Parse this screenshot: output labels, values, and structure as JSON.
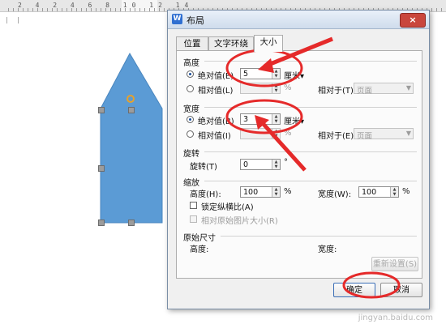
{
  "ruler": {
    "numbers": "2 4 2 4 6 8 10 12 14"
  },
  "dialog": {
    "app_icon": "W",
    "title": "布局",
    "close_label": "×",
    "tabs": [
      {
        "label": "位置"
      },
      {
        "label": "文字环绕"
      },
      {
        "label": "大小"
      }
    ],
    "height_section": {
      "title": "高度",
      "absolute_label": "绝对值(E)",
      "absolute_value": "5",
      "absolute_unit": "厘米",
      "relative_label": "相对值(L)",
      "relative_value": "",
      "relative_unit": "%",
      "relative_to_label": "相对于(T)",
      "relative_to_value": "页面"
    },
    "width_section": {
      "title": "宽度",
      "absolute_label": "绝对值(B)",
      "absolute_value": "3",
      "absolute_unit": "厘米",
      "relative_label": "相对值(I)",
      "relative_value": "",
      "relative_unit": "%",
      "relative_to_label": "相对于(E)",
      "relative_to_value": "页面"
    },
    "rotate_section": {
      "title": "旋转",
      "label": "旋转(T)",
      "value": "0",
      "unit": "°"
    },
    "scale_section": {
      "title": "缩放",
      "height_label": "高度(H):",
      "height_value": "100",
      "width_label": "宽度(W):",
      "width_value": "100",
      "unit": "%",
      "lock_ratio_label": "锁定纵横比(A)",
      "relative_original_label": "相对原始图片大小(R)"
    },
    "original_section": {
      "title": "原始尺寸",
      "height_label": "高度:",
      "width_label": "宽度:",
      "reset_label": "重新设置(S)"
    },
    "ok_label": "确定",
    "cancel_label": "取消"
  },
  "watermark": "jingyan.baidu.com",
  "colors": {
    "shape_fill": "#5b9bd5",
    "annotation_red": "#e52a2a",
    "dialog_bg": "#f0f0f0"
  }
}
